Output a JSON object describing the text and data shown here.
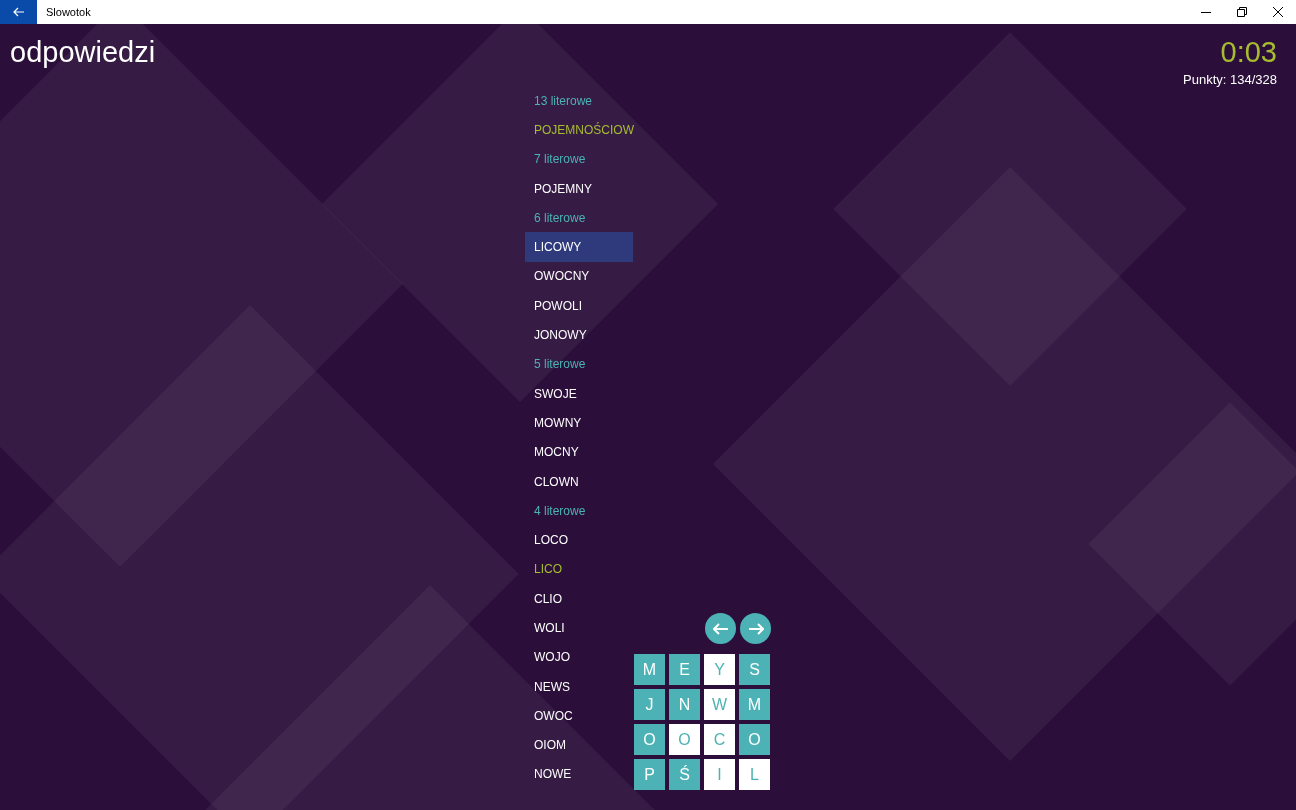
{
  "window": {
    "title": "Slowotok"
  },
  "page_title": "odpowiedzi",
  "timer": "0:03",
  "score": "Punkty: 134/328",
  "answers": [
    {
      "kind": "header",
      "text": "13 literowe"
    },
    {
      "kind": "word",
      "text": "POJEMNOŚCIOW",
      "highlighted": true,
      "selected": false
    },
    {
      "kind": "header",
      "text": "7 literowe"
    },
    {
      "kind": "word",
      "text": "POJEMNY",
      "highlighted": false,
      "selected": false
    },
    {
      "kind": "header",
      "text": "6 literowe"
    },
    {
      "kind": "word",
      "text": "LICOWY",
      "highlighted": false,
      "selected": true
    },
    {
      "kind": "word",
      "text": "OWOCNY",
      "highlighted": false,
      "selected": false
    },
    {
      "kind": "word",
      "text": "POWOLI",
      "highlighted": false,
      "selected": false
    },
    {
      "kind": "word",
      "text": "JONOWY",
      "highlighted": false,
      "selected": false
    },
    {
      "kind": "header",
      "text": "5 literowe"
    },
    {
      "kind": "word",
      "text": "SWOJE",
      "highlighted": false,
      "selected": false
    },
    {
      "kind": "word",
      "text": "MOWNY",
      "highlighted": false,
      "selected": false
    },
    {
      "kind": "word",
      "text": "MOCNY",
      "highlighted": false,
      "selected": false
    },
    {
      "kind": "word",
      "text": "CLOWN",
      "highlighted": false,
      "selected": false
    },
    {
      "kind": "header",
      "text": "4 literowe"
    },
    {
      "kind": "word",
      "text": "LOCO",
      "highlighted": false,
      "selected": false
    },
    {
      "kind": "word",
      "text": "LICO",
      "highlighted": true,
      "selected": false
    },
    {
      "kind": "word",
      "text": "CLIO",
      "highlighted": false,
      "selected": false
    },
    {
      "kind": "word",
      "text": "WOLI",
      "highlighted": false,
      "selected": false
    },
    {
      "kind": "word",
      "text": "WOJO",
      "highlighted": false,
      "selected": false
    },
    {
      "kind": "word",
      "text": "NEWS",
      "highlighted": false,
      "selected": false
    },
    {
      "kind": "word",
      "text": "OWOC",
      "highlighted": false,
      "selected": false
    },
    {
      "kind": "word",
      "text": "OIOM",
      "highlighted": false,
      "selected": false
    },
    {
      "kind": "word",
      "text": "NOWE",
      "highlighted": false,
      "selected": false
    }
  ],
  "board": [
    {
      "letter": "M",
      "highlighted": false
    },
    {
      "letter": "E",
      "highlighted": false
    },
    {
      "letter": "Y",
      "highlighted": true
    },
    {
      "letter": "S",
      "highlighted": false
    },
    {
      "letter": "J",
      "highlighted": false
    },
    {
      "letter": "N",
      "highlighted": false
    },
    {
      "letter": "W",
      "highlighted": true
    },
    {
      "letter": "M",
      "highlighted": false
    },
    {
      "letter": "O",
      "highlighted": false
    },
    {
      "letter": "O",
      "highlighted": true
    },
    {
      "letter": "C",
      "highlighted": true
    },
    {
      "letter": "O",
      "highlighted": false
    },
    {
      "letter": "P",
      "highlighted": false
    },
    {
      "letter": "Ś",
      "highlighted": false
    },
    {
      "letter": "I",
      "highlighted": true
    },
    {
      "letter": "L",
      "highlighted": true
    }
  ]
}
